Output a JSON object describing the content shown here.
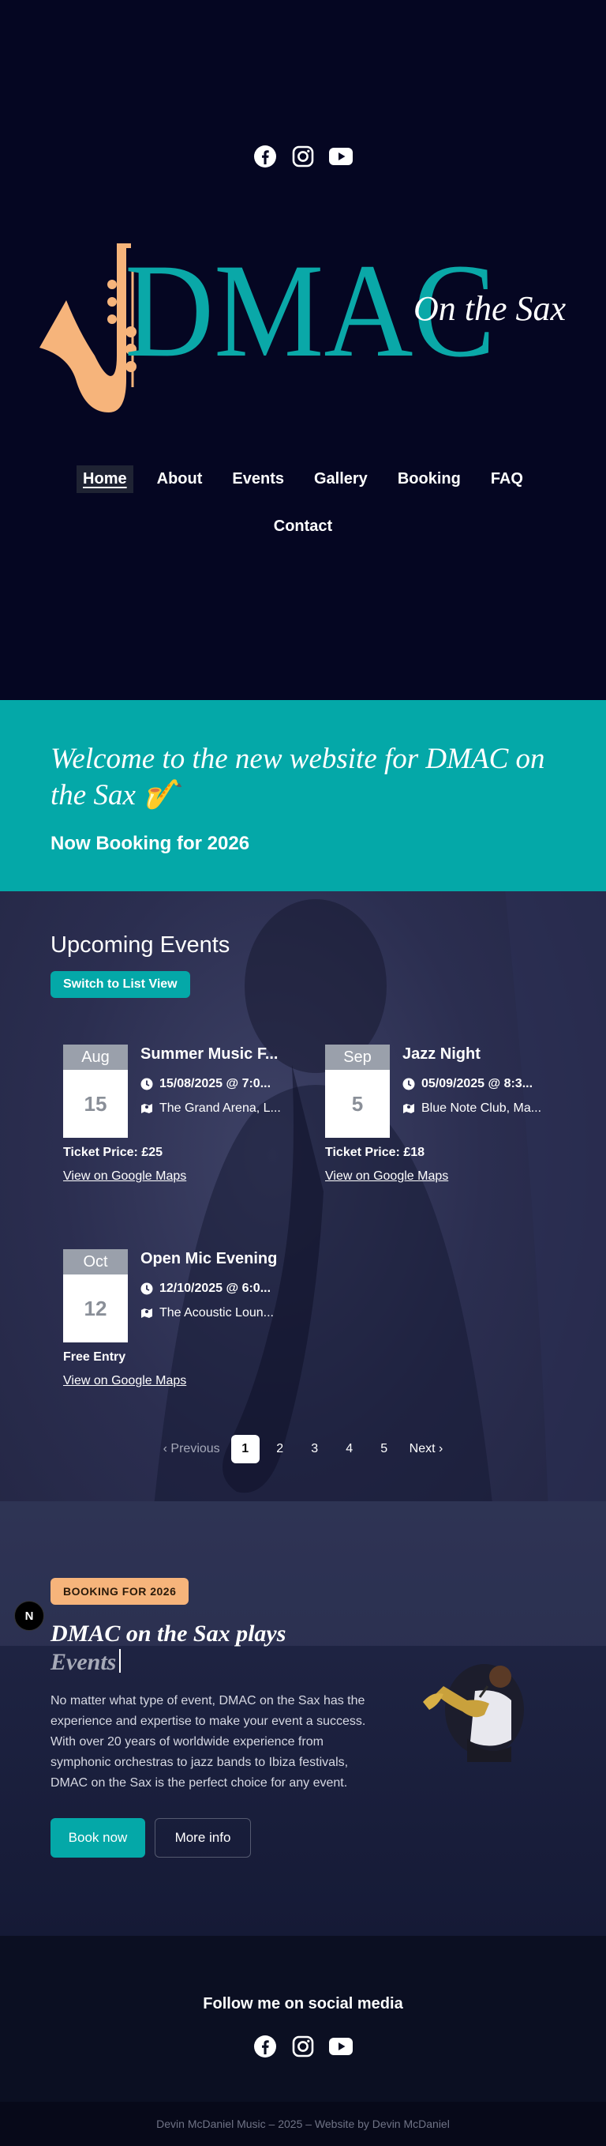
{
  "header": {
    "social_icons": [
      "facebook-icon",
      "instagram-icon",
      "youtube-icon"
    ],
    "logo": {
      "brand": "DMAC",
      "tagline": "On the Sax",
      "brand_color": "#0aa8a8",
      "sax_color": "#f6b47b"
    },
    "nav": {
      "items": [
        {
          "label": "Home",
          "active": true
        },
        {
          "label": "About"
        },
        {
          "label": "Events"
        },
        {
          "label": "Gallery"
        },
        {
          "label": "Booking"
        },
        {
          "label": "FAQ"
        },
        {
          "label": "Contact"
        }
      ]
    }
  },
  "welcome": {
    "heading": "Welcome to the new website for DMAC on the Sax 🎷",
    "subheading": "Now Booking for 2026",
    "background": "#04a8a8"
  },
  "events": {
    "title": "Upcoming Events",
    "switch_label": "Switch to List View",
    "cards": [
      {
        "month": "Aug",
        "day": "15",
        "name": "Summer Music F...",
        "datetime": "15/08/2025 @ 7:0...",
        "location": "The Grand Arena, L...",
        "price": "Ticket Price: £25",
        "map_link": "View on Google Maps"
      },
      {
        "month": "Sep",
        "day": "5",
        "name": "Jazz Night",
        "datetime": "05/09/2025 @ 8:3...",
        "location": "Blue Note Club, Ma...",
        "price": "Ticket Price: £18",
        "map_link": "View on Google Maps"
      },
      {
        "month": "Oct",
        "day": "12",
        "name": "Open Mic Evening",
        "datetime": "12/10/2025 @ 6:0...",
        "location": "The Acoustic Loun...",
        "price": "Free Entry",
        "map_link": "View on Google Maps"
      }
    ],
    "pagination": {
      "prev": "Previous",
      "pages": [
        "1",
        "2",
        "3",
        "4",
        "5"
      ],
      "current": "1",
      "next": "Next"
    }
  },
  "booking": {
    "badge": "BOOKING FOR 2026",
    "title_line1": "DMAC on the Sax plays",
    "title_line2": "Events",
    "text": "No matter what type of event, DMAC on the Sax has the experience and expertise to make your event a success. With over 20 years of worldwide experience from symphonic orchestras to jazz bands to Ibiza festivals, DMAC on the Sax is the perfect choice for any event.",
    "primary_button": "Book now",
    "secondary_button": "More info",
    "badge_color": "#f6b47b"
  },
  "floating_badge": "N",
  "footer": {
    "follow_title": "Follow me on social media",
    "social_icons": [
      "facebook-icon",
      "instagram-icon",
      "youtube-icon"
    ],
    "copyright": "Devin McDaniel Music – 2025 – Website by Devin McDaniel"
  }
}
